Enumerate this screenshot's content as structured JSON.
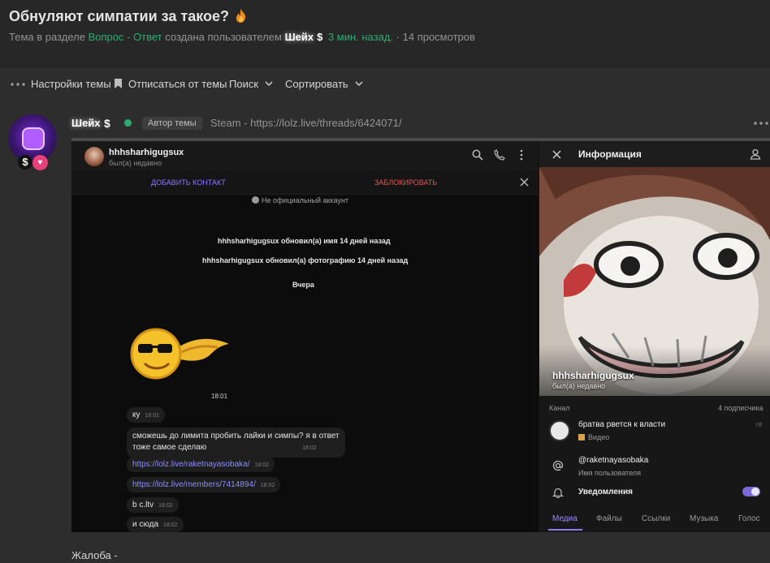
{
  "header": {
    "title": "Обнуляют симпатии за такое?",
    "meta_prefix": "Тема в разделе",
    "section": "Вопрос - Ответ",
    "created_by": "создана пользователем",
    "author": "Шейх",
    "author_badge": "$",
    "time_ago": "3 мин. назад.",
    "views": "· 14 просмотров"
  },
  "toolbar": {
    "settings": "Настройки темы",
    "unsubscribe": "Отписаться от темы",
    "search": "Поиск",
    "sort": "Сортировать"
  },
  "post": {
    "author": "Шейх",
    "author_badge": "$",
    "role_badge": "Автор темы",
    "text": "Steam - https://lolz.live/threads/6424071/",
    "avatar_dollar": "$",
    "complaint": "Жалоба -"
  },
  "chat": {
    "contact_name": "hhhsharhigugsux",
    "contact_status": "был(а) недавно",
    "add_contact": "ДОБАВИТЬ КОНТАКТ",
    "block": "ЗАБЛОКИРОВАТЬ",
    "notice": "Не официальный аккаунт",
    "system_messages": [
      "hhhsharhigugsux обновил(а) имя 14 дней назад",
      "hhhsharhigugsux обновил(а) фотографию 14 дней назад",
      "Вчера"
    ],
    "sticker_time": "18:01",
    "messages": [
      {
        "text": "ку",
        "time": "18:01"
      },
      {
        "text": "сможешь до лимита пробить лайки и симпы? я в ответ",
        "text2": "тоже самое сделаю",
        "time": "18:02"
      },
      {
        "text": "https://lolz.live/raketnayasobaka/",
        "time": "18:02"
      },
      {
        "text": "https://lolz.live/members/7414894/",
        "time": "18:02"
      },
      {
        "text": "b c.ltv",
        "time": "18:02"
      },
      {
        "text": "и сюда",
        "time": "18:02"
      }
    ]
  },
  "info": {
    "title": "Информация",
    "name": "hhhsharhigugsux",
    "status": "был(а) недавно",
    "channel_label": "Канал",
    "subscribers": "4 подписчика",
    "channel_name": "братва рвется к власти",
    "channel_sub": "Видео",
    "username": "@raketnayasobaka",
    "username_label": "Имя пользователя",
    "notifications": "Уведомления",
    "cp": "cp",
    "notifications_on": 1,
    "tabs": [
      "Медиа",
      "Файлы",
      "Ссылки",
      "Музыка",
      "Голос"
    ],
    "accent_color": "#8e7bff"
  }
}
